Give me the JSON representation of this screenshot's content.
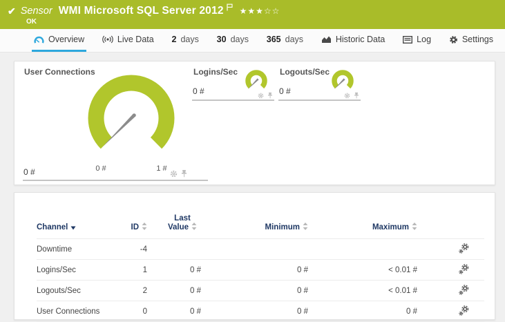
{
  "header": {
    "kind": "Sensor",
    "title": "WMI Microsoft SQL Server 2012",
    "status": "OK",
    "rating": {
      "filled": "★★★",
      "empty": "☆☆",
      "value": "3 of 5"
    }
  },
  "tabs": {
    "overview": "Overview",
    "live_data": "Live Data",
    "d2_num": "2",
    "d2_unit": "days",
    "d30_num": "30",
    "d30_unit": "days",
    "d365_num": "365",
    "d365_unit": "days",
    "historic": "Historic Data",
    "log": "Log",
    "settings": "Settings"
  },
  "gauges": {
    "user_connections": {
      "title": "User Connections",
      "value": "0 #",
      "scale_min": "0 #",
      "scale_max": "1 #"
    },
    "logins": {
      "title": "Logins/Sec",
      "value": "0 #"
    },
    "logouts": {
      "title": "Logouts/Sec",
      "value": "0 #"
    }
  },
  "table": {
    "headers": {
      "channel": "Channel",
      "id": "ID",
      "last_value": "Last Value",
      "minimum": "Minimum",
      "maximum": "Maximum"
    },
    "rows": [
      {
        "channel": "Downtime",
        "id": "-4",
        "last": "",
        "min": "",
        "max": ""
      },
      {
        "channel": "Logins/Sec",
        "id": "1",
        "last": "0 #",
        "min": "0 #",
        "max": "< 0.01 #"
      },
      {
        "channel": "Logouts/Sec",
        "id": "2",
        "last": "0 #",
        "min": "0 #",
        "max": "< 0.01 #"
      },
      {
        "channel": "User Connections",
        "id": "0",
        "last": "0 #",
        "min": "0 #",
        "max": "0 #"
      }
    ]
  },
  "colors": {
    "status_green": "#a9bc29",
    "gauge_green": "#b1c62c",
    "accent_blue": "#2da8dd",
    "table_header_navy": "#1f3864",
    "needle_gray": "#8c8c8c"
  }
}
